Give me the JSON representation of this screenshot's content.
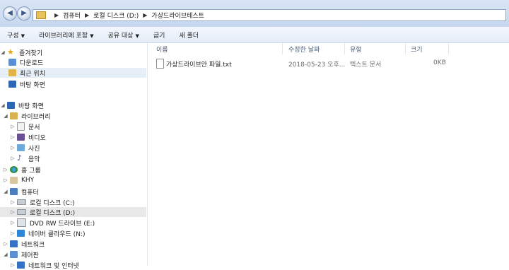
{
  "address": {
    "crumbs": [
      "컴퓨터",
      "로컬 디스크 (D:)",
      "가상드라이브테스트"
    ]
  },
  "toolbar": {
    "organize": "구성",
    "include_library": "라이브러리에 포함",
    "share_with": "공유 대상",
    "burn": "굽기",
    "new_folder": "새 폴더"
  },
  "sidebar": {
    "favorites": "즐겨찾기",
    "downloads": "다운로드",
    "recent": "최근 위치",
    "desktop_fav": "바탕 화면",
    "desktop": "바탕 화면",
    "libraries": "라이브러리",
    "documents": "문서",
    "videos": "비디오",
    "pictures": "사진",
    "music": "음악",
    "homegroup": "홈 그룹",
    "user": "KHY",
    "computer": "컴퓨터",
    "drive_c": "로컬 디스크 (C:)",
    "drive_d": "로컬 디스크 (D:)",
    "drive_e": "DVD RW 드라이브 (E:)",
    "drive_n": "네이버 클라우드 (N:)",
    "network": "네트워크",
    "control_panel": "제어판",
    "network_internet": "네트워크 및 인터넷"
  },
  "columns": {
    "name": "이름",
    "modified": "수정한 날짜",
    "type": "유형",
    "size": "크기"
  },
  "files": [
    {
      "name": "가상드라이브안 파일.txt",
      "modified": "2018-05-23 오후...",
      "type": "텍스트 문서",
      "size": "0KB"
    }
  ]
}
